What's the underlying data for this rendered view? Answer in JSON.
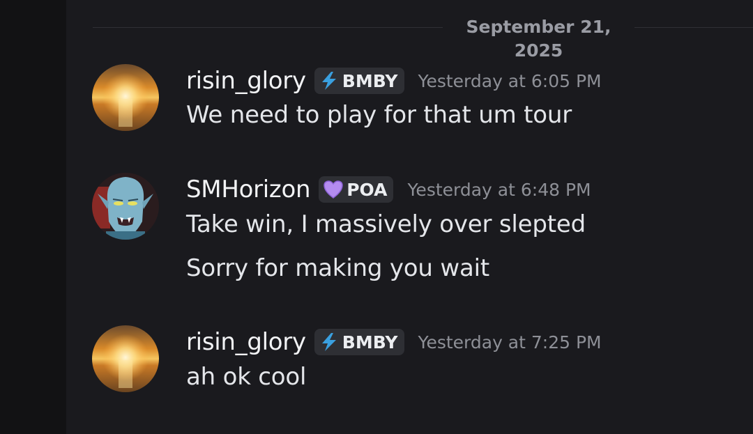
{
  "divider": {
    "date": "September 21, 2025"
  },
  "messages": [
    {
      "username": "risin_glory",
      "tag": "BMBY",
      "tag_icon": "lightning-icon",
      "timestamp": "Yesterday at 6:05 PM",
      "lines": [
        "We need to play for that um tour"
      ]
    },
    {
      "username": "SMHorizon",
      "tag": "POA",
      "tag_icon": "purple-heart-icon",
      "timestamp": "Yesterday at 6:48 PM",
      "lines": [
        "Take win, I massively over slepted",
        "Sorry for making you wait"
      ]
    },
    {
      "username": "risin_glory",
      "tag": "BMBY",
      "tag_icon": "lightning-icon",
      "timestamp": "Yesterday at 7:25 PM",
      "lines": [
        "ah ok cool"
      ]
    }
  ],
  "colors": {
    "background": "#1a1a1e",
    "side_strip": "#121214",
    "username": "#f2f3f5",
    "timestamp": "#8e9097",
    "tag_bg": "#2e2f34",
    "lightning": "#3aa0e0",
    "heart": "#b48cf0"
  }
}
